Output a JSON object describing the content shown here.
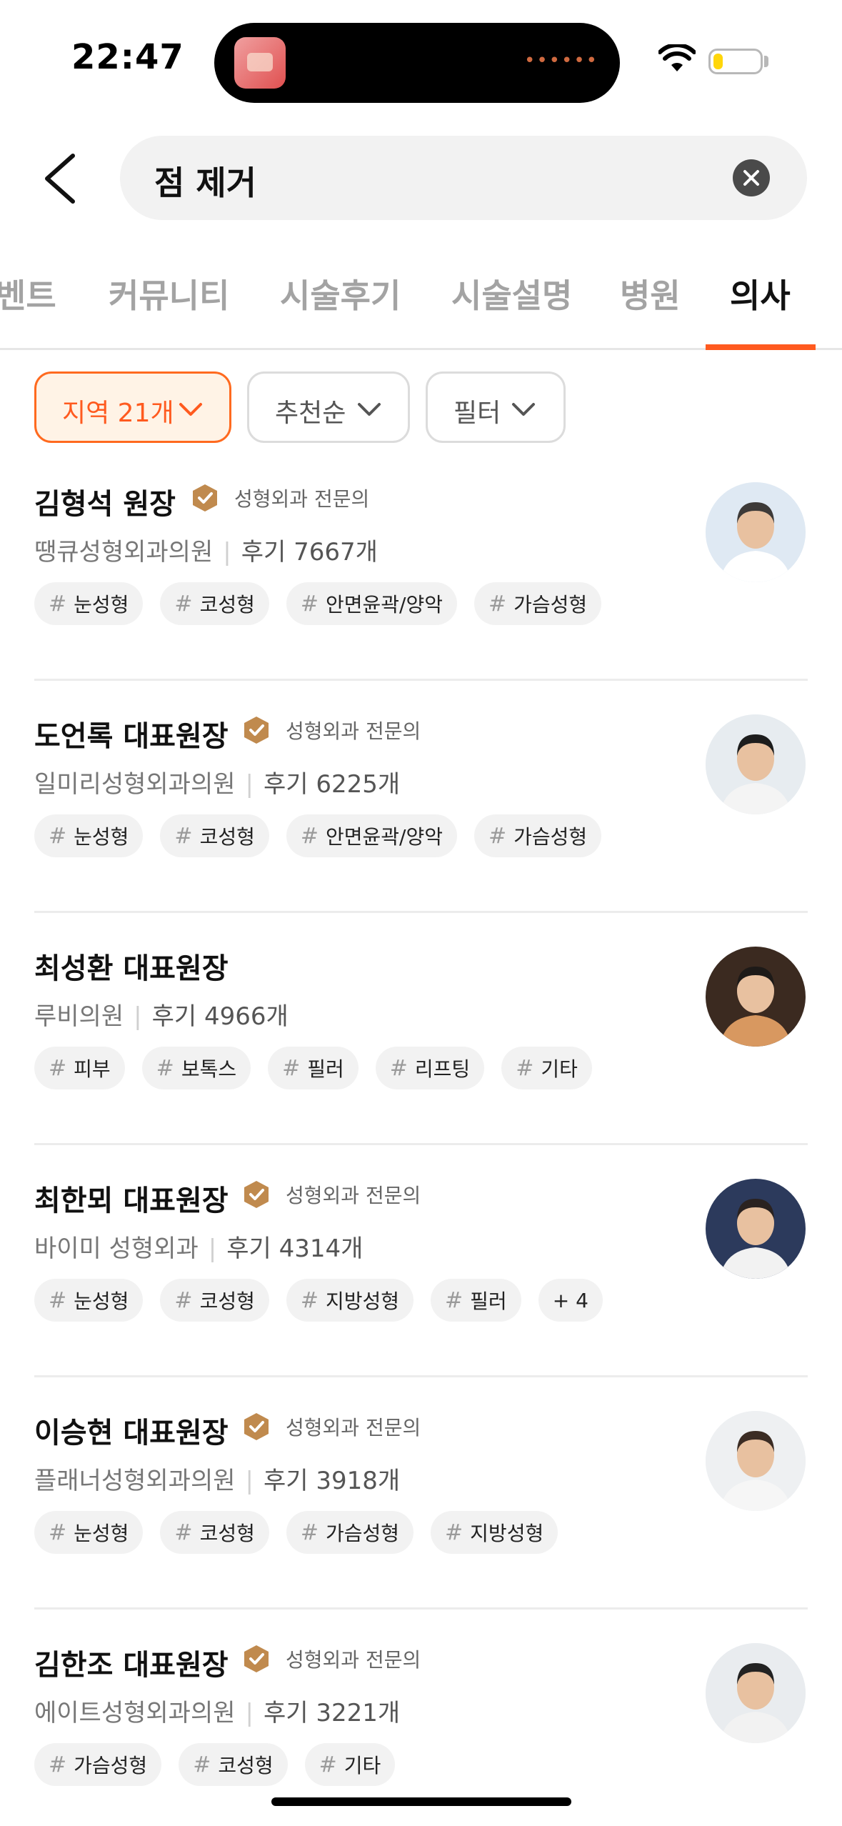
{
  "status": {
    "time": "22:47",
    "battery_level": 0.2
  },
  "search": {
    "query": "점 제거"
  },
  "tabs": [
    {
      "label": "벤트",
      "active": false
    },
    {
      "label": "커뮤니티",
      "active": false
    },
    {
      "label": "시술후기",
      "active": false
    },
    {
      "label": "시술설명",
      "active": false
    },
    {
      "label": "병원",
      "active": false
    },
    {
      "label": "의사",
      "active": true
    }
  ],
  "filters": [
    {
      "label": "지역 21개",
      "active": true
    },
    {
      "label": "추천순",
      "active": false
    },
    {
      "label": "필터",
      "active": false
    }
  ],
  "doctors": [
    {
      "name": "김형석 원장",
      "badge": "성형외과 전문의",
      "clinic": "땡큐성형외과의원",
      "reviews": "후기 7667개",
      "tags": [
        "눈성형",
        "코성형",
        "안면윤곽/양악",
        "가슴성형"
      ],
      "extra": ""
    },
    {
      "name": "도언록 대표원장",
      "badge": "성형외과 전문의",
      "clinic": "일미리성형외과의원",
      "reviews": "후기 6225개",
      "tags": [
        "눈성형",
        "코성형",
        "안면윤곽/양악",
        "가슴성형"
      ],
      "extra": ""
    },
    {
      "name": "최성환 대표원장",
      "badge": "",
      "clinic": "루비의원",
      "reviews": "후기 4966개",
      "tags": [
        "피부",
        "보톡스",
        "필러",
        "리프팅",
        "기타"
      ],
      "extra": ""
    },
    {
      "name": "최한뫼 대표원장",
      "badge": "성형외과 전문의",
      "clinic": "바이미 성형외과",
      "reviews": "후기 4314개",
      "tags": [
        "눈성형",
        "코성형",
        "지방성형",
        "필러"
      ],
      "extra": "+ 4"
    },
    {
      "name": "이승현 대표원장",
      "badge": "성형외과 전문의",
      "clinic": "플래너성형외과의원",
      "reviews": "후기 3918개",
      "tags": [
        "눈성형",
        "코성형",
        "가슴성형",
        "지방성형"
      ],
      "extra": ""
    },
    {
      "name": "김한조 대표원장",
      "badge": "성형외과 전문의",
      "clinic": "에이트성형외과의원",
      "reviews": "후기 3221개",
      "tags": [
        "가슴성형",
        "코성형",
        "기타"
      ],
      "extra": ""
    }
  ],
  "colors": {
    "accent": "#ff5a1f",
    "badge": "#c08a4e",
    "chip_active_bg": "#fff3e6"
  },
  "icons": {
    "back": "chevron-left-icon",
    "clear": "close-circle-icon",
    "verified": "verified-badge-icon",
    "dropdown": "chevron-down-icon"
  }
}
